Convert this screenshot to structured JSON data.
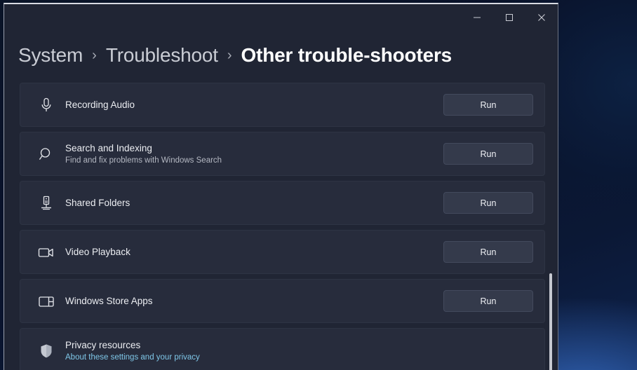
{
  "window": {
    "controls": [
      {
        "name": "minimize",
        "glyph": "minimize-icon"
      },
      {
        "name": "maximize",
        "glyph": "maximize-icon"
      },
      {
        "name": "close",
        "glyph": "close-icon"
      }
    ]
  },
  "breadcrumb": {
    "separator": "›",
    "items": [
      {
        "label": "System",
        "current": false
      },
      {
        "label": "Troubleshoot",
        "current": false
      },
      {
        "label": "Other trouble-shooters",
        "current": true
      }
    ]
  },
  "troubleshooters": [
    {
      "icon": "microphone-icon",
      "title": "Recording Audio",
      "subtitle": "",
      "action": "Run"
    },
    {
      "icon": "search-icon",
      "title": "Search and Indexing",
      "subtitle": "Find and fix problems with Windows Search",
      "action": "Run"
    },
    {
      "icon": "server-icon",
      "title": "Shared Folders",
      "subtitle": "",
      "action": "Run"
    },
    {
      "icon": "video-camera-icon",
      "title": "Video Playback",
      "subtitle": "",
      "action": "Run"
    },
    {
      "icon": "app-layout-icon",
      "title": "Windows Store Apps",
      "subtitle": "",
      "action": "Run"
    }
  ],
  "privacy": {
    "icon": "shield-icon",
    "title": "Privacy resources",
    "link_text": "About these settings and your privacy"
  },
  "colors": {
    "window_bg": "#202534",
    "card_bg": "#272c3c",
    "button_bg": "#343a4b",
    "accent_link": "#7fc7e8",
    "text_primary": "#eceef2",
    "text_secondary": "#b4b8c2",
    "desktop_bg": "#0a1428"
  },
  "scrollbar": {
    "position": "right",
    "thumb_visible": true
  }
}
